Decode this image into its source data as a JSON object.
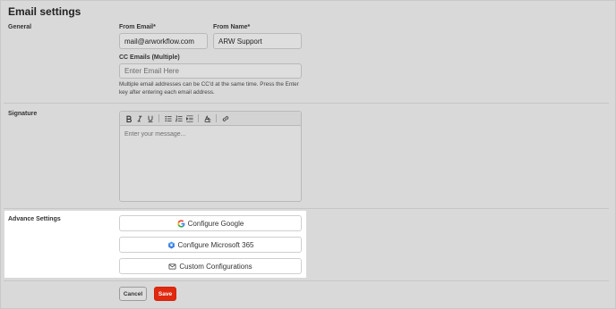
{
  "page": {
    "title": "Email settings"
  },
  "general": {
    "section_label": "General",
    "from_email": {
      "label": "From Email*",
      "value": "mail@arworkflow.com"
    },
    "from_name": {
      "label": "From Name*",
      "value": "ARW Support"
    },
    "cc_emails": {
      "label": "CC Emails (Multiple)",
      "placeholder": "Enter Email Here",
      "helper": "Multiple email addresses can be CC'd at the same time. Press the Enter key after entering each email address."
    }
  },
  "signature": {
    "section_label": "Signature",
    "placeholder": "Enter your message...",
    "toolbar_icons": [
      "bold-icon",
      "italic-icon",
      "underline-icon",
      "bulleted-list-icon",
      "numbered-list-icon",
      "indent-icon",
      "clear-format-icon",
      "link-icon"
    ]
  },
  "advance": {
    "section_label": "Advance Settings",
    "google_label": "Configure Google",
    "microsoft_label": "Configure Microsoft 365",
    "custom_label": "Custom Configurations"
  },
  "actions": {
    "cancel_label": "Cancel",
    "save_label": "Save"
  },
  "colors": {
    "save": "#e0290f",
    "google_blue": "#4285F4",
    "google_red": "#EA4335",
    "google_yellow": "#FBBC05",
    "google_green": "#34A853",
    "microsoft_blue": "#3b7de0"
  }
}
